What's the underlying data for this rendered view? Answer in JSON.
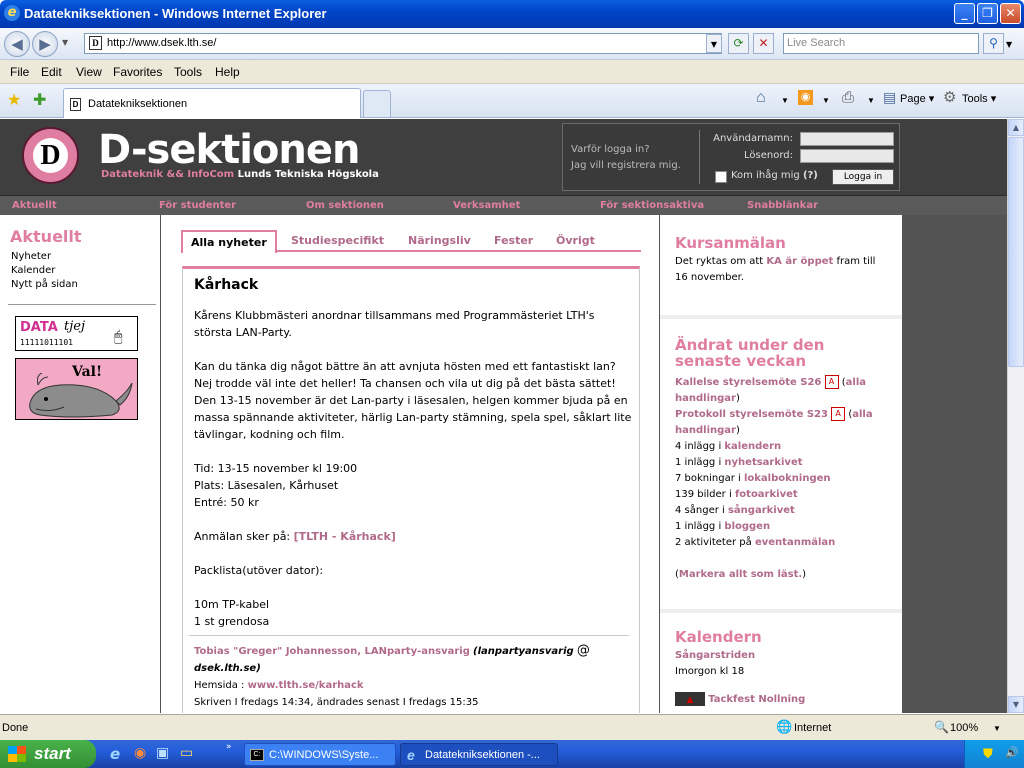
{
  "window": {
    "title": "Datatekniksektionen - Windows Internet Explorer",
    "address": "http://www.dsek.lth.se/",
    "search_placeholder": "Live Search",
    "tab_title": "Datatekniksektionen"
  },
  "menu": [
    "File",
    "Edit",
    "View",
    "Favorites",
    "Tools",
    "Help"
  ],
  "toolbar": {
    "page": "Page",
    "tools": "Tools"
  },
  "site": {
    "title": "D-sektionen",
    "subtitle_pink": "Datateknik && InfoCom",
    "subtitle_white": "Lunds Tekniska Högskola",
    "logo_glyph": "D"
  },
  "login": {
    "why_login": "Varför logga in?",
    "register": "Jag vill registrera mig.",
    "username_label": "Användarnamn:",
    "password_label": "Lösenord:",
    "remember_label": "Kom ihåg mig",
    "help": "(?)",
    "button": "Logga in"
  },
  "nav": [
    "Aktuellt",
    "För studenter",
    "Om sektionen",
    "Verksamhet",
    "För sektionsaktiva",
    "Snabblänkar"
  ],
  "left": {
    "heading": "Aktuellt",
    "links": [
      "Nyheter",
      "Kalender",
      "Nytt på sidan"
    ],
    "datatjej": {
      "data": "DATA",
      "tjej": "tjej",
      "bits": "11111011101"
    },
    "val": "Val!"
  },
  "tabs": [
    "Alla nyheter",
    "Studiespecifikt",
    "Näringsliv",
    "Fester",
    "Övrigt"
  ],
  "article": {
    "title": "Kårhack",
    "p1": "Kårens Klubbmästeri anordnar tillsammans med Programmästeriet LTH's största LAN-Party.",
    "p2": "Kan du tänka dig något bättre än att avnjuta hösten med ett fantastiskt lan? Nej trodde väl inte det heller! Ta chansen och vila ut dig på det bästa sättet! Den 13-15 november är det Lan-party i läsesalen, helgen kommer bjuda på en massa spännande aktiviteter, härlig Lan-party stämning, spela spel, såklart lite tävlingar, kodning och film.",
    "tid": "Tid: 13-15 november kl 19:00",
    "plats": "Plats: Läsesalen, Kårhuset",
    "entre": "Entré: 50 kr",
    "anmalan_prefix": "Anmälan sker på:",
    "anmalan_link": "[TLTH - Kårhack]",
    "packlista": "Packlista(utöver dator):",
    "item1": "10m TP-kabel",
    "item2": "1 st grendosa",
    "author": "Tobias \"Greger\" Johannesson, LANparty-ansvarig",
    "email_user": "(lanpartyansvarig",
    "email_at": "@",
    "email_domain": "dsek.lth.se)",
    "homepage_label": "Hemsida :",
    "homepage": "www.tlth.se/karhack",
    "written": "Skriven I fredags 14:34, ändrades senast I fredags 15:35"
  },
  "kurs": {
    "heading": "Kursanmälan",
    "text_pre": "Det ryktas om att",
    "link": "KA är öppet",
    "text_post": "fram till 16 november."
  },
  "changed": {
    "heading": "Ändrat under den senaste veckan",
    "doc1": "Kallelse styrelsemöte S26",
    "doc2": "Protokoll styrelsemöte S23",
    "alla_open": "(",
    "alla": "alla handlingar",
    "alla_close": ")",
    "rows": [
      {
        "pre": "4 inlägg i",
        "link": "kalendern"
      },
      {
        "pre": "1 inlägg i",
        "link": "nyhetsarkivet"
      },
      {
        "pre": "7 bokningar i",
        "link": "lokalbokningen"
      },
      {
        "pre": "139 bilder i",
        "link": "fotoarkivet"
      },
      {
        "pre": "4 sånger i",
        "link": "sångarkivet"
      },
      {
        "pre": "1 inlägg i",
        "link": "bloggen"
      },
      {
        "pre": "2 aktiviteter på",
        "link": "eventanmälan"
      }
    ],
    "mark_open": "(",
    "mark": "Markera allt som läst.",
    "mark_close": ")"
  },
  "calendar": {
    "heading": "Kalendern",
    "event1": "Sångarstriden",
    "event1_time": "Imorgon kl 18",
    "event2": "Tackfest Nollning"
  },
  "status": {
    "left": "Done",
    "zone": "Internet",
    "zoom": "100%"
  },
  "taskbar": {
    "start": "start",
    "task1": "C:\\WINDOWS\\Syste...",
    "task2": "Datatekniksektionen -..."
  },
  "colors": {
    "accent": "#e07ea2",
    "link": "#b06a8a",
    "header_bg": "#3f3f3f"
  }
}
